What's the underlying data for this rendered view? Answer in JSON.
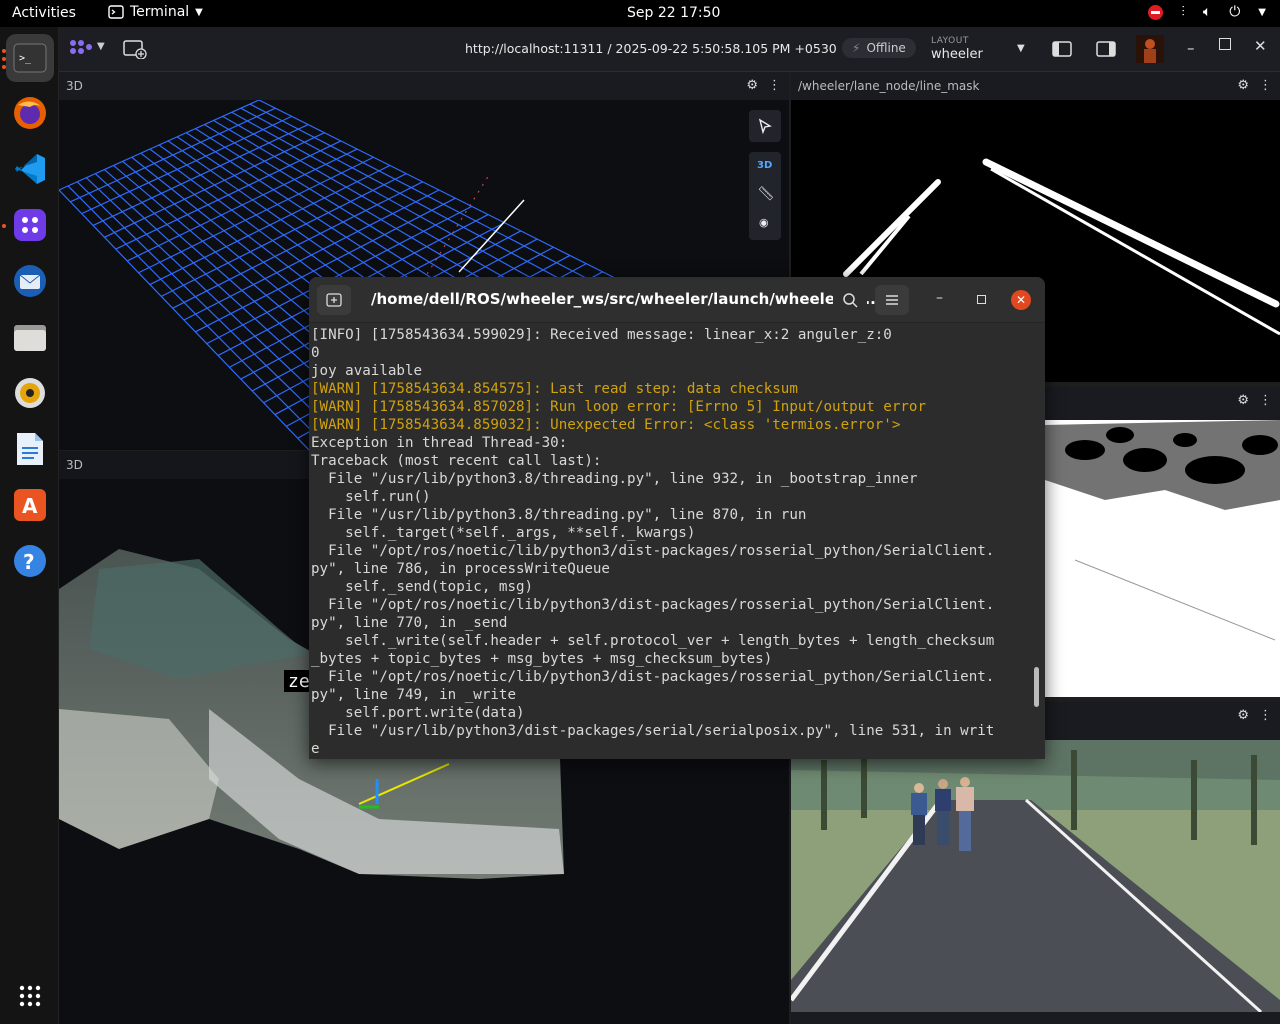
{
  "topbar": {
    "activities": "Activities",
    "app_name": "Terminal",
    "clock": "Sep 22  17:50"
  },
  "dock": {
    "items": [
      "terminal-icon",
      "firefox-icon",
      "vscode-icon",
      "foxglove-icon",
      "thunderbird-icon",
      "files-icon",
      "rhythmbox-icon",
      "writer-icon",
      "app-center-icon",
      "help-icon",
      "apps-grid-icon"
    ]
  },
  "foxglove": {
    "url": "http://localhost:11311 / 2025-09-22 5:50:58.105 PM +0530",
    "offline": "Offline",
    "layout_label": "LAYOUT",
    "layout_value": "wheeler"
  },
  "panels": {
    "tl_title": "3D",
    "bl_title": "3D",
    "tr_title": "/wheeler/lane_node/line_mask",
    "view3d_label": "3D",
    "ze_label": "ze"
  },
  "terminal": {
    "title": "/home/dell/ROS/wheeler_ws/src/wheeler/launch/wheeler_c...",
    "lines": [
      {
        "t": "[INFO] [1758543634.599029]: Received message: linear_x:2 anguler_z:0",
        "c": "info"
      },
      {
        "t": "0",
        "c": "info"
      },
      {
        "t": "joy available",
        "c": "info"
      },
      {
        "t": "[WARN] [1758543634.854575]: Last read step: data checksum",
        "c": "warn"
      },
      {
        "t": "[WARN] [1758543634.857028]: Run loop error: [Errno 5] Input/output error",
        "c": "warn"
      },
      {
        "t": "[WARN] [1758543634.859032]: Unexpected Error: <class 'termios.error'>",
        "c": "warn"
      },
      {
        "t": "Exception in thread Thread-30:",
        "c": "info"
      },
      {
        "t": "Traceback (most recent call last):",
        "c": "info"
      },
      {
        "t": "  File \"/usr/lib/python3.8/threading.py\", line 932, in _bootstrap_inner",
        "c": "info"
      },
      {
        "t": "    self.run()",
        "c": "info"
      },
      {
        "t": "  File \"/usr/lib/python3.8/threading.py\", line 870, in run",
        "c": "info"
      },
      {
        "t": "    self._target(*self._args, **self._kwargs)",
        "c": "info"
      },
      {
        "t": "  File \"/opt/ros/noetic/lib/python3/dist-packages/rosserial_python/SerialClient.",
        "c": "info"
      },
      {
        "t": "py\", line 786, in processWriteQueue",
        "c": "info"
      },
      {
        "t": "    self._send(topic, msg)",
        "c": "info"
      },
      {
        "t": "  File \"/opt/ros/noetic/lib/python3/dist-packages/rosserial_python/SerialClient.",
        "c": "info"
      },
      {
        "t": "py\", line 770, in _send",
        "c": "info"
      },
      {
        "t": "    self._write(self.header + self.protocol_ver + length_bytes + length_checksum",
        "c": "info"
      },
      {
        "t": "_bytes + topic_bytes + msg_bytes + msg_checksum_bytes)",
        "c": "info"
      },
      {
        "t": "  File \"/opt/ros/noetic/lib/python3/dist-packages/rosserial_python/SerialClient.",
        "c": "info"
      },
      {
        "t": "py\", line 749, in _write",
        "c": "info"
      },
      {
        "t": "    self.port.write(data)",
        "c": "info"
      },
      {
        "t": "  File \"/usr/lib/python3/dist-packages/serial/serialposix.py\", line 531, in writ",
        "c": "info"
      },
      {
        "t": "e",
        "c": "info"
      }
    ]
  },
  "colors": {
    "warn": "#d1a20c",
    "close": "#e0481f",
    "grid": "#2d6bff"
  }
}
